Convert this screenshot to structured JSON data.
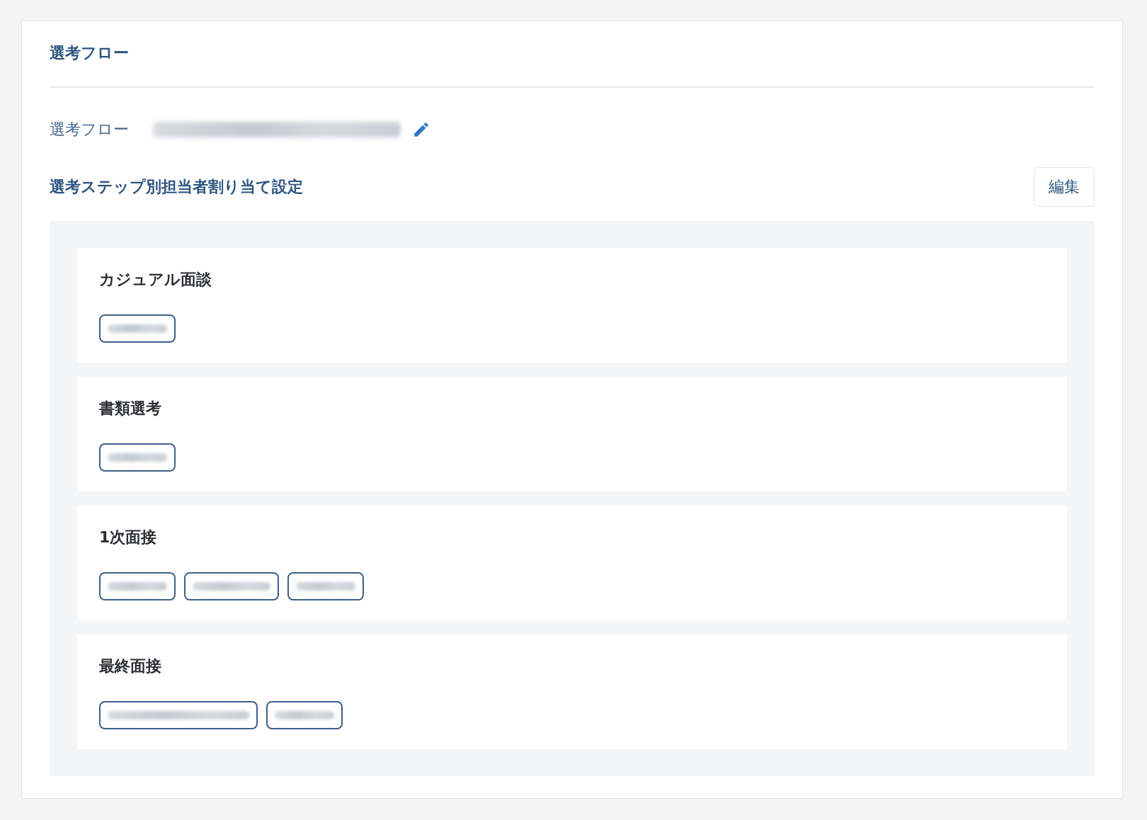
{
  "panel": {
    "title": "選考フロー"
  },
  "flow_row": {
    "label": "選考フロー",
    "value": {
      "kind": "long"
    },
    "edit_icon": true
  },
  "assignment": {
    "title": "選考ステップ別担当者割り当て設定",
    "edit_button": "編集"
  },
  "steps": [
    {
      "name": "カジュアル面談",
      "assignees": [
        {
          "kind": "short"
        }
      ]
    },
    {
      "name": "書類選考",
      "assignees": [
        {
          "kind": "short"
        }
      ]
    },
    {
      "name": "1次面接",
      "assignees": [
        {
          "kind": "short"
        },
        {
          "kind": "medium"
        },
        {
          "kind": "short"
        }
      ]
    },
    {
      "name": "最終面接",
      "assignees": [
        {
          "kind": "long"
        },
        {
          "kind": "short"
        }
      ]
    }
  ]
}
